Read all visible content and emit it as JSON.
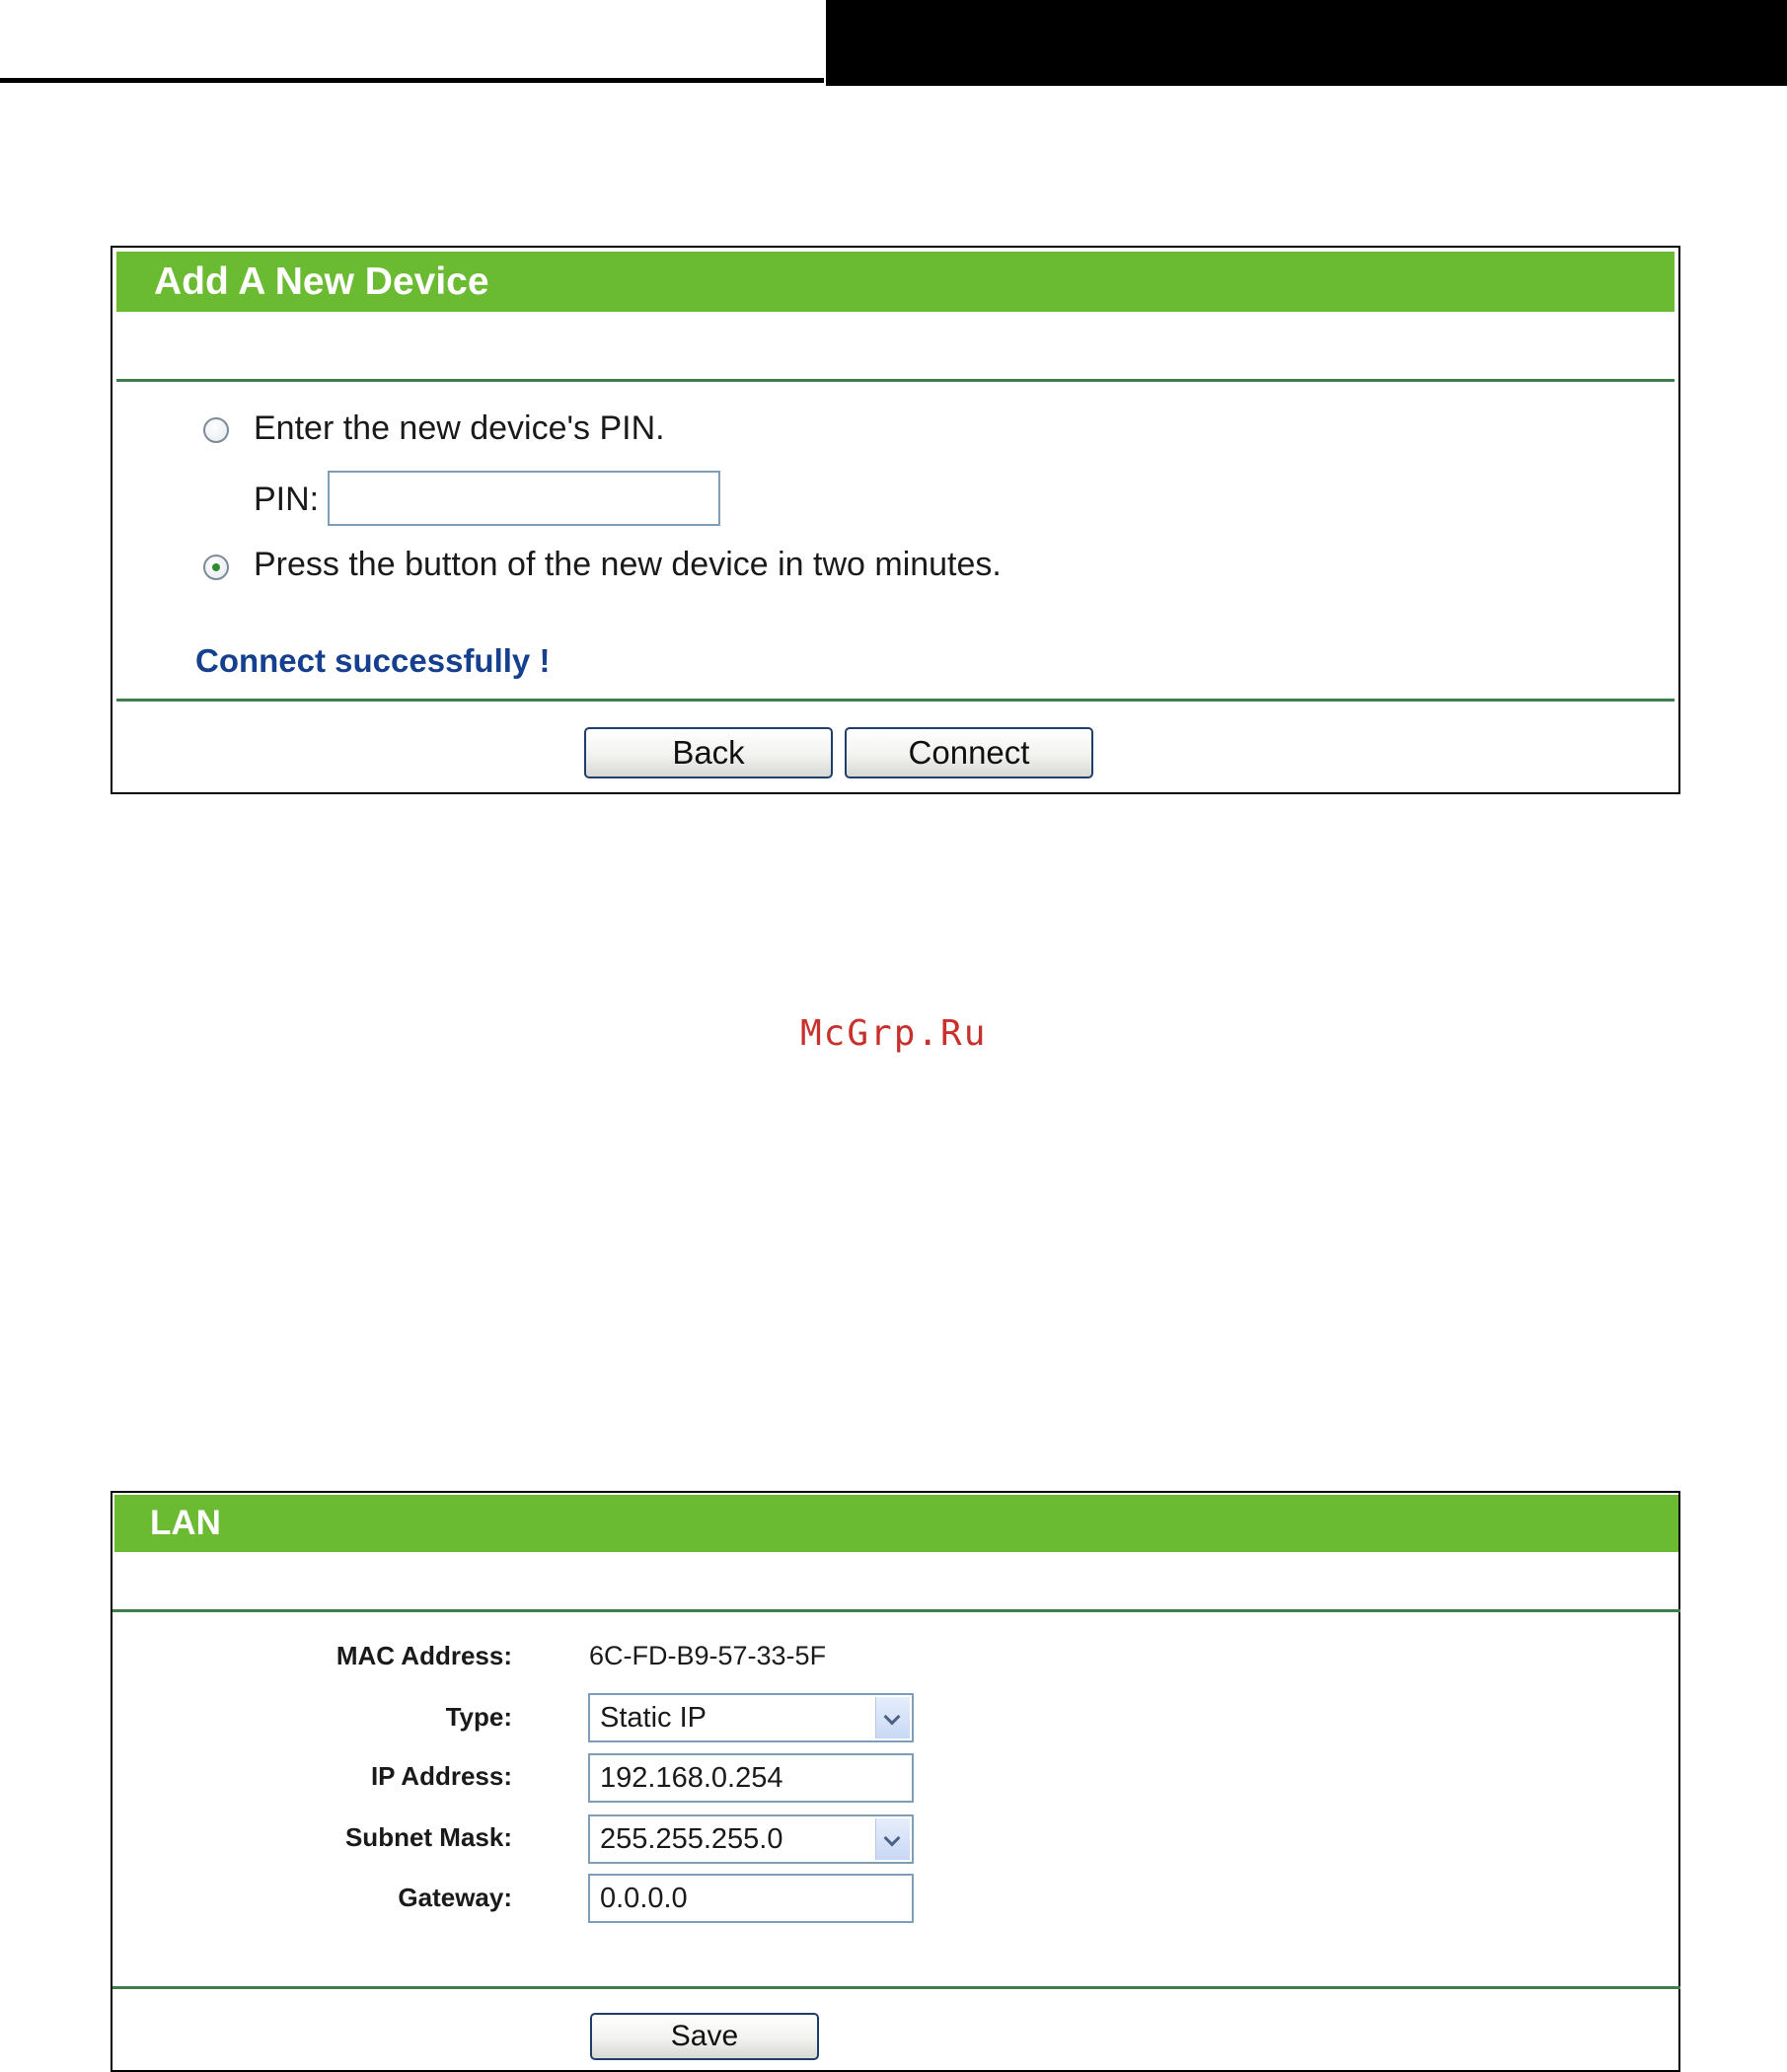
{
  "wps_panel": {
    "title": "Add A New Device",
    "option_pin_label": "Enter the new device's PIN.",
    "pin_label": "PIN:",
    "pin_value": "",
    "option_button_label": "Press the button of the new device in two minutes.",
    "selected_option": "button",
    "status": "Connect successfully !",
    "back_label": "Back",
    "connect_label": "Connect"
  },
  "watermark": "McGrp.Ru",
  "lan_panel": {
    "title": "LAN",
    "mac_label": "MAC Address:",
    "mac_value": "6C-FD-B9-57-33-5F",
    "type_label": "Type:",
    "type_value": "Static IP",
    "ip_label": "IP Address:",
    "ip_value": "192.168.0.254",
    "subnet_label": "Subnet Mask:",
    "subnet_value": "255.255.255.0",
    "gateway_label": "Gateway:",
    "gateway_value": "0.0.0.0",
    "save_label": "Save"
  },
  "colors": {
    "title_bar": "#6abb32",
    "divider": "#3f7d4a",
    "status_text": "#153f8f",
    "watermark": "#c8302b"
  }
}
